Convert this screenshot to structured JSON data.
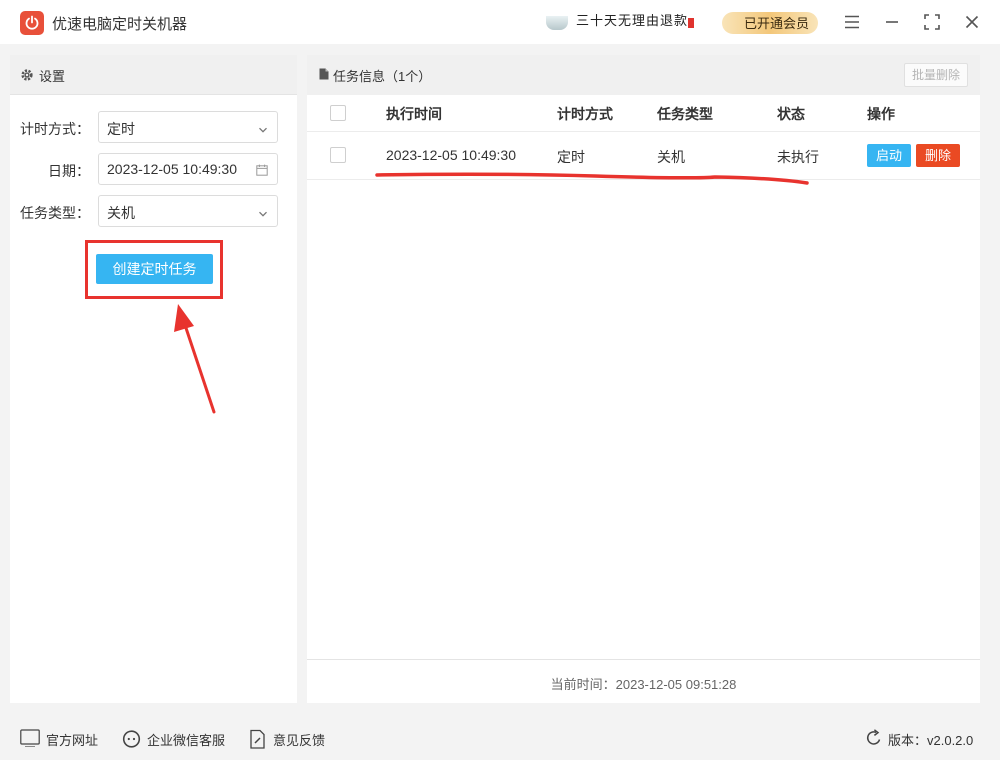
{
  "app": {
    "title": "优速电脑定时关机器"
  },
  "promos": {
    "first": "三十天无理由退款",
    "second": "已开通会员"
  },
  "window_controls": [
    "menu-icon",
    "minimize-icon",
    "maximize-icon",
    "close-icon"
  ],
  "settings_panel": {
    "title": "设置",
    "timing_mode": {
      "label": "计时方式：",
      "value": "定时"
    },
    "date": {
      "label": "日期：",
      "value": "2023-12-05 10:49:30"
    },
    "task_type": {
      "label": "任务类型：",
      "value": "关机"
    },
    "create_button": "创建定时任务"
  },
  "task_panel": {
    "title": "任务信息（1个）",
    "batch_delete": "批量删除",
    "columns": [
      "执行时间",
      "计时方式",
      "任务类型",
      "状态",
      "操作"
    ],
    "rows": [
      {
        "exec_time": "2023-12-05 10:49:30",
        "mode": "定时",
        "type": "关机",
        "status": "未执行",
        "start_label": "启动",
        "delete_label": "删除"
      }
    ],
    "current_time": "当前时间：2023-12-05 09:51:28"
  },
  "footer": {
    "website": "官方网址",
    "wechat": "企业微信客服",
    "feedback": "意见反馈",
    "version": "版本：v2.0.2.0"
  },
  "colors": {
    "accent": "#36b5f2",
    "danger": "#ea4a23",
    "annotation": "#e8332e",
    "logo": "#e8503a"
  }
}
